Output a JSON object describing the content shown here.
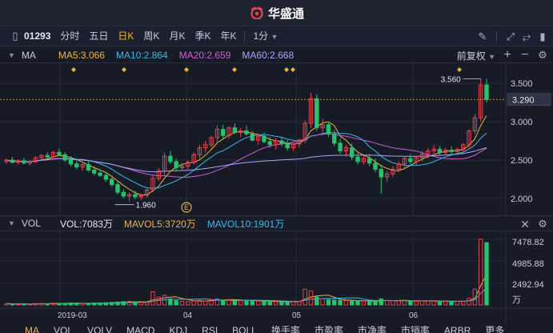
{
  "app": {
    "logo_text": "华盛通"
  },
  "toolbar": {
    "code": "01293",
    "periods": [
      "分时",
      "五日",
      "日K",
      "周K",
      "月K",
      "季K",
      "年K"
    ],
    "active_period": "日K",
    "interval": "1分"
  },
  "main_legend": {
    "name": "MA",
    "ma5": "MA5:3.066",
    "ma10": "MA10:2.864",
    "ma20": "MA20:2.659",
    "ma60": "MA60:2.668",
    "adjust": "前复权",
    "colors": {
      "ma5": "#f0b43a",
      "ma10": "#3cb7e6",
      "ma20": "#d05cd8",
      "ma60": "#a3a8ff"
    }
  },
  "vol_legend": {
    "name": "VOL",
    "vol": "VOL:7083万",
    "mavol5": "MAVOL5:3720万",
    "mavol10": "MAVOL10:1901万"
  },
  "price_axis": {
    "labels": [
      "3.500",
      "3.000",
      "2.500",
      "2.000"
    ],
    "current": "3.290",
    "high_label": "3.560",
    "low_label": "1.960"
  },
  "vol_axis": {
    "labels": [
      "7478.82",
      "4985.88",
      "2492.94",
      "万"
    ]
  },
  "x_axis": {
    "labels": [
      "2019-03",
      "04",
      "05",
      "06"
    ]
  },
  "event_marker": "E",
  "bottom_tabs": [
    "MA",
    "VOL",
    "VOLV",
    "MACD",
    "KDJ",
    "RSI",
    "BOLL",
    "换手率",
    "市盈率",
    "市净率",
    "市销率",
    "ARBR",
    "更多"
  ],
  "active_tab": "MA",
  "colors": {
    "up": "#e8434f",
    "down": "#27c26c",
    "bg": "#161b26",
    "accent": "#f0b43a"
  },
  "chart_data": {
    "type": "candlestick",
    "candles_ohlc": [
      [
        2.48,
        2.52,
        2.45,
        2.5
      ],
      [
        2.5,
        2.54,
        2.46,
        2.47
      ],
      [
        2.47,
        2.51,
        2.44,
        2.49
      ],
      [
        2.49,
        2.53,
        2.45,
        2.46
      ],
      [
        2.46,
        2.5,
        2.43,
        2.48
      ],
      [
        2.48,
        2.55,
        2.46,
        2.53
      ],
      [
        2.53,
        2.58,
        2.5,
        2.56
      ],
      [
        2.56,
        2.6,
        2.52,
        2.54
      ],
      [
        2.54,
        2.62,
        2.51,
        2.6
      ],
      [
        2.6,
        2.65,
        2.55,
        2.57
      ],
      [
        2.57,
        2.6,
        2.48,
        2.5
      ],
      [
        2.5,
        2.55,
        2.42,
        2.45
      ],
      [
        2.45,
        2.49,
        2.38,
        2.41
      ],
      [
        2.41,
        2.46,
        2.36,
        2.44
      ],
      [
        2.44,
        2.48,
        2.35,
        2.37
      ],
      [
        2.37,
        2.42,
        2.3,
        2.33
      ],
      [
        2.33,
        2.38,
        2.28,
        2.3
      ],
      [
        2.3,
        2.34,
        2.22,
        2.25
      ],
      [
        2.25,
        2.3,
        2.15,
        2.18
      ],
      [
        2.18,
        2.22,
        2.05,
        2.08
      ],
      [
        2.08,
        2.12,
        2.0,
        2.03
      ],
      [
        2.03,
        2.08,
        1.96,
        2.05
      ],
      [
        2.05,
        2.1,
        1.99,
        2.02
      ],
      [
        2.02,
        2.06,
        1.98,
        2.04
      ],
      [
        2.04,
        2.14,
        2.01,
        2.11
      ],
      [
        2.11,
        2.3,
        2.08,
        2.26
      ],
      [
        2.26,
        2.4,
        2.22,
        2.36
      ],
      [
        2.36,
        2.6,
        2.3,
        2.55
      ],
      [
        2.55,
        2.62,
        2.45,
        2.48
      ],
      [
        2.48,
        2.52,
        2.35,
        2.4
      ],
      [
        2.4,
        2.46,
        2.36,
        2.42
      ],
      [
        2.42,
        2.5,
        2.38,
        2.47
      ],
      [
        2.47,
        2.6,
        2.44,
        2.57
      ],
      [
        2.57,
        2.7,
        2.52,
        2.66
      ],
      [
        2.66,
        2.75,
        2.6,
        2.7
      ],
      [
        2.7,
        2.82,
        2.66,
        2.79
      ],
      [
        2.79,
        2.95,
        2.74,
        2.9
      ],
      [
        2.9,
        2.96,
        2.78,
        2.82
      ],
      [
        2.82,
        2.94,
        2.78,
        2.92
      ],
      [
        2.92,
        2.98,
        2.84,
        2.86
      ],
      [
        2.86,
        2.92,
        2.8,
        2.88
      ],
      [
        2.88,
        2.95,
        2.82,
        2.84
      ],
      [
        2.84,
        2.88,
        2.74,
        2.76
      ],
      [
        2.76,
        2.85,
        2.7,
        2.81
      ],
      [
        2.81,
        2.86,
        2.72,
        2.74
      ],
      [
        2.74,
        2.8,
        2.66,
        2.7
      ],
      [
        2.7,
        2.78,
        2.64,
        2.75
      ],
      [
        2.75,
        2.8,
        2.68,
        2.72
      ],
      [
        2.72,
        2.76,
        2.62,
        2.66
      ],
      [
        2.66,
        2.74,
        2.62,
        2.71
      ],
      [
        2.71,
        2.78,
        2.66,
        2.76
      ],
      [
        2.76,
        3.02,
        2.72,
        2.98
      ],
      [
        2.98,
        3.38,
        2.92,
        3.3
      ],
      [
        3.3,
        3.36,
        2.88,
        2.92
      ],
      [
        2.92,
        3.04,
        2.82,
        2.96
      ],
      [
        2.96,
        3.0,
        2.8,
        2.84
      ],
      [
        2.84,
        2.9,
        2.68,
        2.72
      ],
      [
        2.72,
        2.78,
        2.58,
        2.62
      ],
      [
        2.62,
        2.7,
        2.54,
        2.66
      ],
      [
        2.66,
        2.72,
        2.5,
        2.54
      ],
      [
        2.54,
        2.6,
        2.44,
        2.48
      ],
      [
        2.48,
        2.56,
        2.44,
        2.52
      ],
      [
        2.52,
        2.58,
        2.42,
        2.46
      ],
      [
        2.46,
        2.52,
        2.34,
        2.38
      ],
      [
        2.38,
        2.44,
        2.06,
        2.28
      ],
      [
        2.28,
        2.36,
        2.22,
        2.32
      ],
      [
        2.32,
        2.42,
        2.28,
        2.38
      ],
      [
        2.38,
        2.48,
        2.34,
        2.45
      ],
      [
        2.45,
        2.55,
        2.4,
        2.52
      ],
      [
        2.52,
        2.58,
        2.44,
        2.48
      ],
      [
        2.48,
        2.56,
        2.44,
        2.53
      ],
      [
        2.53,
        2.62,
        2.48,
        2.58
      ],
      [
        2.58,
        2.66,
        2.52,
        2.62
      ],
      [
        2.62,
        2.7,
        2.56,
        2.64
      ],
      [
        2.64,
        2.68,
        2.56,
        2.6
      ],
      [
        2.6,
        2.66,
        2.56,
        2.63
      ],
      [
        2.63,
        2.68,
        2.58,
        2.61
      ],
      [
        2.61,
        2.66,
        2.56,
        2.64
      ],
      [
        2.64,
        2.72,
        2.6,
        2.7
      ],
      [
        2.7,
        2.9,
        2.66,
        2.88
      ],
      [
        2.88,
        3.1,
        2.84,
        3.05
      ],
      [
        3.05,
        3.56,
        3.0,
        3.48
      ],
      [
        3.48,
        3.56,
        3.25,
        3.29
      ]
    ],
    "volumes_wan": [
      150,
      120,
      100,
      130,
      110,
      160,
      180,
      140,
      200,
      170,
      190,
      230,
      210,
      170,
      160,
      220,
      240,
      260,
      300,
      340,
      380,
      420,
      360,
      300,
      280,
      1500,
      900,
      1100,
      700,
      500,
      420,
      380,
      460,
      520,
      480,
      600,
      700,
      560,
      620,
      520,
      480,
      500,
      460,
      440,
      420,
      400,
      380,
      360,
      340,
      380,
      420,
      1800,
      1600,
      900,
      700,
      600,
      560,
      520,
      500,
      480,
      460,
      440,
      420,
      400,
      700,
      520,
      480,
      460,
      500,
      440,
      420,
      460,
      480,
      440,
      420,
      400,
      380,
      420,
      460,
      760,
      1800,
      7478,
      7083
    ],
    "price_range": [
      1.8,
      3.7
    ],
    "volume_max_wan": 8000
  }
}
